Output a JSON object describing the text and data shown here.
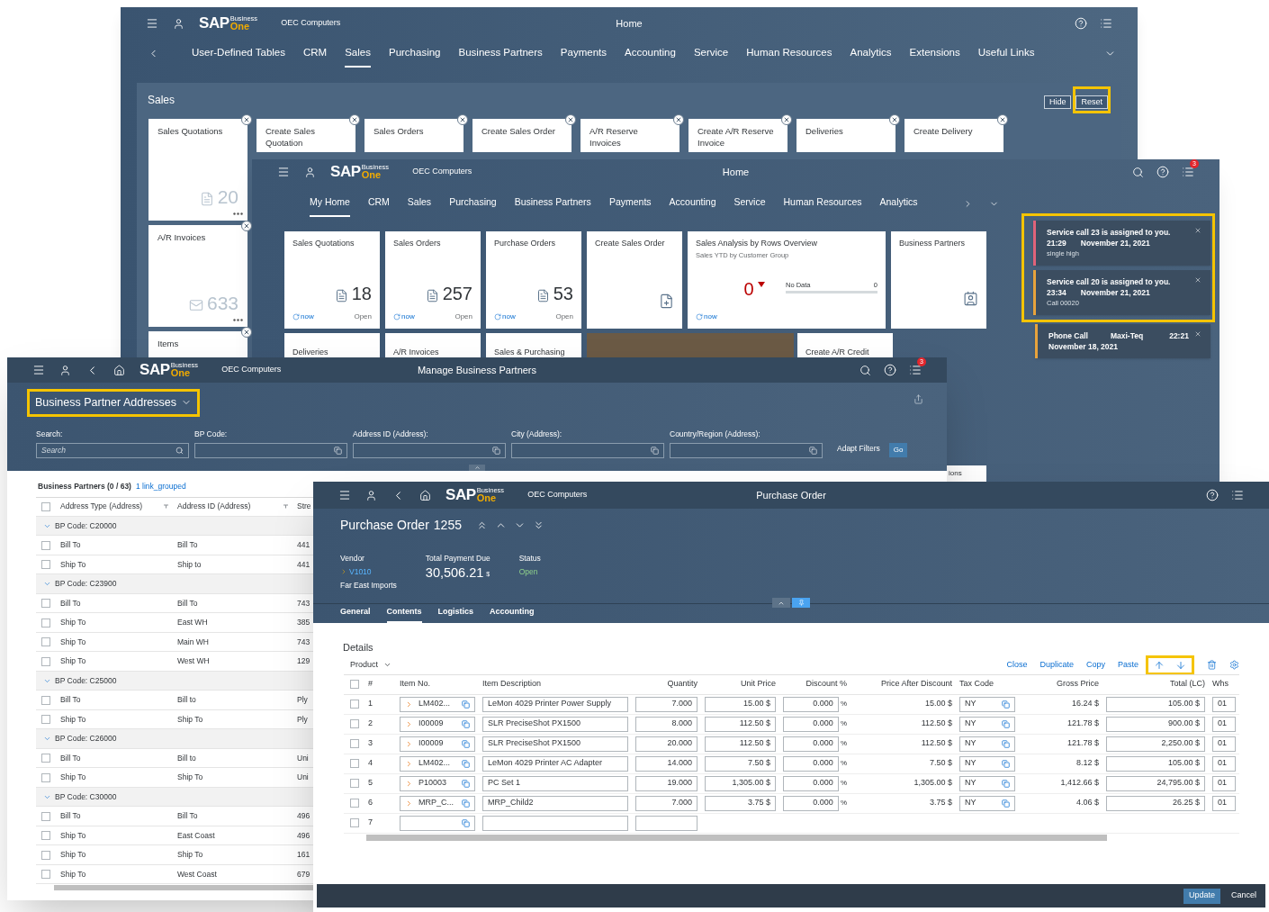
{
  "home_window": {
    "logo": [
      "SAP",
      "Business",
      "One"
    ],
    "company": "OEC Computers",
    "title": "Home",
    "nav": [
      {
        "label": "User-Defined Tables",
        "selected": false
      },
      {
        "label": "CRM",
        "selected": false
      },
      {
        "label": "Sales",
        "selected": true
      },
      {
        "label": "Purchasing",
        "selected": false
      },
      {
        "label": "Business Partners",
        "selected": false
      },
      {
        "label": "Payments",
        "selected": false
      },
      {
        "label": "Accounting",
        "selected": false
      },
      {
        "label": "Service",
        "selected": false
      },
      {
        "label": "Human Resources",
        "selected": false
      },
      {
        "label": "Analytics",
        "selected": false
      },
      {
        "label": "Extensions",
        "selected": false
      },
      {
        "label": "Useful Links",
        "selected": false
      }
    ],
    "section": {
      "title": "Sales",
      "buttons": [
        {
          "label": "Hide",
          "highlighted": false
        },
        {
          "label": "Reset",
          "highlighted": true
        }
      ]
    },
    "column_tiles": [
      {
        "kind": "quotation",
        "title": "Sales Quotations",
        "count": "20"
      },
      {
        "kind": "invoice",
        "title": "A/R Invoices",
        "count": "633"
      },
      {
        "kind": "plain",
        "title": "Items"
      }
    ],
    "row_tiles": [
      "Create Sales Quotation",
      "Sales Orders",
      "Create Sales Order",
      "A/R Reserve Invoices",
      "Create A/R Reserve Invoice",
      "Deliveries",
      "Create Delivery"
    ]
  },
  "home_window_2": {
    "logo": [
      "SAP",
      "Business",
      "One"
    ],
    "company": "OEC Computers",
    "title": "Home",
    "badge": "3",
    "nav": [
      {
        "label": "My Home",
        "selected": true
      },
      {
        "label": "CRM",
        "selected": false
      },
      {
        "label": "Sales",
        "selected": false
      },
      {
        "label": "Purchasing",
        "selected": false
      },
      {
        "label": "Business Partners",
        "selected": false
      },
      {
        "label": "Payments",
        "selected": false
      },
      {
        "label": "Accounting",
        "selected": false
      },
      {
        "label": "Service",
        "selected": false
      },
      {
        "label": "Human Resources",
        "selected": false
      },
      {
        "label": "Analytics",
        "selected": false
      }
    ],
    "tiles": [
      {
        "kind": "count",
        "title": "Sales Quotations",
        "value": "18",
        "refresh": "now",
        "action": "Open"
      },
      {
        "kind": "count",
        "title": "Sales Orders",
        "value": "257",
        "refresh": "now",
        "action": "Open"
      },
      {
        "kind": "count",
        "title": "Purchase Orders",
        "value": "53",
        "refresh": "now",
        "action": "Open"
      },
      {
        "kind": "create",
        "title": "Create Sales Order"
      },
      {
        "kind": "analysis",
        "title": "Sales Analysis by Rows Overview",
        "subtitle": "Sales YTD by Customer Group",
        "value": "0",
        "no_data": "No Data",
        "axis_value": "0",
        "refresh": "now"
      },
      {
        "kind": "contact",
        "title": "Business Partners"
      }
    ],
    "tiles_row_2": [
      {
        "kind": "text",
        "title": "Deliveries"
      },
      {
        "kind": "text",
        "title": "A/R Invoices"
      },
      {
        "kind": "text",
        "title": "Sales & Purchasing"
      },
      {
        "kind": "photo"
      },
      {
        "kind": "text",
        "title": "Create A/R Credit"
      }
    ],
    "partial_tile": "ions"
  },
  "notifications": [
    {
      "title": "Service call 23 is assigned to you.",
      "time": "21:29",
      "date": "November 21, 2021",
      "note": "single high",
      "color": "#e0637a",
      "highlighted": true
    },
    {
      "title": "Service call 20 is assigned to you.",
      "time": "23:34",
      "date": "November 21, 2021",
      "note": "Call 00020",
      "color": "#e8a33c",
      "highlighted": true
    },
    {
      "title": "Phone Call",
      "from": "Maxi-Teq",
      "time": "22:21",
      "date": "November 18, 2021",
      "color": "#e8a33c",
      "highlighted": false
    }
  ],
  "bp_window": {
    "logo": [
      "SAP",
      "Business",
      "One"
    ],
    "company": "OEC Computers",
    "title": "Manage Business Partners",
    "badge": "3",
    "variant": {
      "label": "Business Partner Addresses",
      "highlighted": true
    },
    "filters": [
      {
        "label": "Search:",
        "placeholder": "Search",
        "kind": "search"
      },
      {
        "label": "BP Code:",
        "kind": "value_help"
      },
      {
        "label": "Address ID (Address):",
        "kind": "value_help"
      },
      {
        "label": "City (Address):",
        "kind": "value_help"
      },
      {
        "label": "Country/Region (Address):",
        "kind": "value_help"
      }
    ],
    "adapt_filters": "Adapt Filters",
    "go": "Go",
    "table": {
      "all_checked": false,
      "caption": "Business Partners (0 / 63)",
      "link": "1 link_grouped",
      "columns": [
        "Address Type (Address)",
        "Address ID (Address)",
        "Stre"
      ],
      "groups": [
        {
          "label": "BP Code: C20000",
          "expanded": true,
          "rows": [
            {
              "checked": false,
              "cells": [
                "Bill To",
                "Bill To",
                "441"
              ]
            },
            {
              "checked": false,
              "cells": [
                "Ship To",
                "Ship to",
                "441"
              ]
            }
          ]
        },
        {
          "label": "BP Code: C23900",
          "expanded": true,
          "rows": [
            {
              "checked": false,
              "cells": [
                "Bill To",
                "Bill To",
                "743"
              ]
            },
            {
              "checked": false,
              "cells": [
                "Ship To",
                "East WH",
                "385"
              ]
            },
            {
              "checked": false,
              "cells": [
                "Ship To",
                "Main WH",
                "743"
              ]
            },
            {
              "checked": false,
              "cells": [
                "Ship To",
                "West WH",
                "129"
              ]
            }
          ]
        },
        {
          "label": "BP Code: C25000",
          "expanded": true,
          "rows": [
            {
              "checked": false,
              "cells": [
                "Bill To",
                "Bill to",
                "Ply"
              ]
            },
            {
              "checked": false,
              "cells": [
                "Ship To",
                "Ship To",
                "Ply"
              ]
            }
          ]
        },
        {
          "label": "BP Code: C26000",
          "expanded": true,
          "rows": [
            {
              "checked": false,
              "cells": [
                "Bill To",
                "Bill to",
                "Uni"
              ]
            },
            {
              "checked": false,
              "cells": [
                "Ship To",
                "Ship To",
                "Uni"
              ]
            }
          ]
        },
        {
          "label": "BP Code: C30000",
          "expanded": true,
          "rows": [
            {
              "checked": false,
              "cells": [
                "Bill To",
                "Bill To",
                "496"
              ]
            },
            {
              "checked": false,
              "cells": [
                "Ship To",
                "East Coast",
                "496"
              ]
            },
            {
              "checked": false,
              "cells": [
                "Ship To",
                "Ship To",
                "161"
              ]
            },
            {
              "checked": false,
              "cells": [
                "Ship To",
                "West Coast",
                "679"
              ]
            }
          ]
        }
      ]
    }
  },
  "po_window": {
    "logo": [
      "SAP",
      "Business",
      "One"
    ],
    "company": "OEC Computers",
    "title": "Purchase Order",
    "doc": {
      "title": "Purchase Order",
      "number": "1255"
    },
    "fields": {
      "vendor_label": "Vendor",
      "vendor_code": "V1010",
      "vendor_name": "Far East Imports",
      "total_label": "Total Payment Due",
      "total": "30,506.21",
      "currency": "$",
      "status_label": "Status",
      "status": "Open"
    },
    "tabs": [
      {
        "label": "General",
        "selected": false
      },
      {
        "label": "Contents",
        "selected": true
      },
      {
        "label": "Logistics",
        "selected": false
      },
      {
        "label": "Accounting",
        "selected": false
      }
    ],
    "details": {
      "all_checked": false,
      "title": "Details",
      "filter": "Product",
      "actions": [
        "Close",
        "Duplicate",
        "Copy",
        "Paste"
      ],
      "move_highlighted": true,
      "columns": [
        "#",
        "Item No.",
        "Item Description",
        "Quantity",
        "Unit Price",
        "Discount %",
        "Price After Discount",
        "Tax Code",
        "Gross Price",
        "Total (LC)",
        "Whs"
      ],
      "rows": [
        {
          "kind": "line",
          "checked": false,
          "no": "1",
          "item": "LM402...",
          "desc": "LeMon 4029 Printer Power Supply",
          "qty": "7.000",
          "unit_price": "15.00 $",
          "discount": "0.000",
          "pct": "%",
          "after": "15.00 $",
          "tax": "NY",
          "gross": "16.24 $",
          "total": "105.00 $",
          "whs": "01"
        },
        {
          "kind": "line",
          "checked": false,
          "no": "2",
          "item": "I00009",
          "desc": "SLR PreciseShot PX1500",
          "qty": "8.000",
          "unit_price": "112.50 $",
          "discount": "0.000",
          "pct": "%",
          "after": "112.50 $",
          "tax": "NY",
          "gross": "121.78 $",
          "total": "900.00 $",
          "whs": "01"
        },
        {
          "kind": "line",
          "checked": false,
          "no": "3",
          "item": "I00009",
          "desc": "SLR PreciseShot PX1500",
          "qty": "20.000",
          "unit_price": "112.50 $",
          "discount": "0.000",
          "pct": "%",
          "after": "112.50 $",
          "tax": "NY",
          "gross": "121.78 $",
          "total": "2,250.00 $",
          "whs": "01"
        },
        {
          "kind": "line",
          "checked": false,
          "no": "4",
          "item": "LM402...",
          "desc": "LeMon 4029 Printer AC Adapter",
          "qty": "14.000",
          "unit_price": "7.50 $",
          "discount": "0.000",
          "pct": "%",
          "after": "7.50 $",
          "tax": "NY",
          "gross": "8.12 $",
          "total": "105.00 $",
          "whs": "01"
        },
        {
          "kind": "line",
          "checked": false,
          "no": "5",
          "item": "P10003",
          "desc": "PC Set 1",
          "qty": "19.000",
          "unit_price": "1,305.00 $",
          "discount": "0.000",
          "pct": "%",
          "after": "1,305.00 $",
          "tax": "NY",
          "gross": "1,412.66 $",
          "total": "24,795.00 $",
          "whs": "01"
        },
        {
          "kind": "line",
          "checked": false,
          "no": "6",
          "item": "MRP_C...",
          "desc": "MRP_Child2",
          "qty": "7.000",
          "unit_price": "3.75 $",
          "discount": "0.000",
          "pct": "%",
          "after": "3.75 $",
          "tax": "NY",
          "gross": "4.06 $",
          "total": "26.25 $",
          "whs": "01"
        },
        {
          "kind": "new",
          "checked": false,
          "no": "7"
        }
      ]
    },
    "footer": {
      "update": "Update",
      "cancel": "Cancel"
    }
  }
}
